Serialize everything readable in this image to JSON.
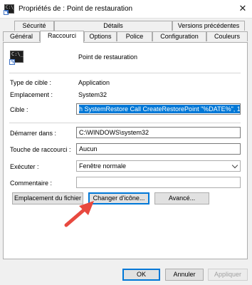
{
  "window": {
    "title": "Propriétés de : Point de restauration",
    "close_glyph": "✕"
  },
  "tabs_row1": [
    "Sécurité",
    "Détails",
    "Versions précédentes"
  ],
  "tabs_row2": [
    "Général",
    "Raccourci",
    "Options",
    "Police",
    "Configuration",
    "Couleurs"
  ],
  "active_tab": "Raccourci",
  "shortcut": {
    "name": "Point de restauration",
    "icon_text": "C:\\_",
    "target_type_label": "Type de cible :",
    "target_type": "Application",
    "location_label": "Emplacement :",
    "location": "System32",
    "target_label": "Cible :",
    "target_value": "h SystemRestore Call CreateRestorePoint \"%DATE%\", 100, 7\"",
    "start_in_label": "Démarrer dans :",
    "start_in_value": "C:\\WINDOWS\\system32",
    "hotkey_label": "Touche de raccourci :",
    "hotkey_value": "Aucun",
    "run_label": "Exécuter :",
    "run_value": "Fenêtre normale",
    "comment_label": "Commentaire :",
    "comment_value": ""
  },
  "buttons": {
    "open_location": "Emplacement du fichier",
    "change_icon": "Changer d'icône...",
    "advanced": "Avancé...",
    "ok": "OK",
    "cancel": "Annuler",
    "apply": "Appliquer"
  },
  "colors": {
    "selection": "#0078d7",
    "annotation_arrow": "#e8493f"
  }
}
